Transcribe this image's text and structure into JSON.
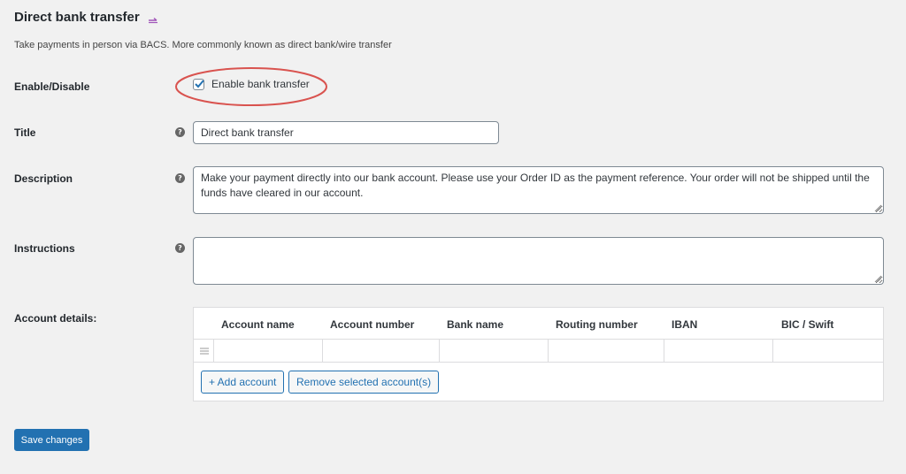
{
  "header": {
    "title": "Direct bank transfer",
    "description": "Take payments in person via BACS. More commonly known as direct bank/wire transfer"
  },
  "icons": {
    "return": "return-arrow-icon",
    "help": "question-mark-icon",
    "drag": "drag-handle-icon",
    "help_glyph": "?"
  },
  "fields": {
    "enable": {
      "label": "Enable/Disable",
      "checkbox_label": "Enable bank transfer",
      "checked": true
    },
    "title": {
      "label": "Title",
      "value": "Direct bank transfer"
    },
    "description": {
      "label": "Description",
      "value": "Make your payment directly into our bank account. Please use your Order ID as the payment reference. Your order will not be shipped until the funds have cleared in our account."
    },
    "instructions": {
      "label": "Instructions",
      "value": ""
    },
    "account_details": {
      "label": "Account details:",
      "columns": [
        "Account name",
        "Account number",
        "Bank name",
        "Routing number",
        "IBAN",
        "BIC / Swift"
      ],
      "rows": [
        [
          "",
          "",
          "",
          "",
          "",
          ""
        ]
      ],
      "add_label": "+ Add account",
      "remove_label": "Remove selected account(s)"
    }
  },
  "save_label": "Save changes",
  "colors": {
    "primary": "#2271b1",
    "highlight": "#d9534f"
  }
}
